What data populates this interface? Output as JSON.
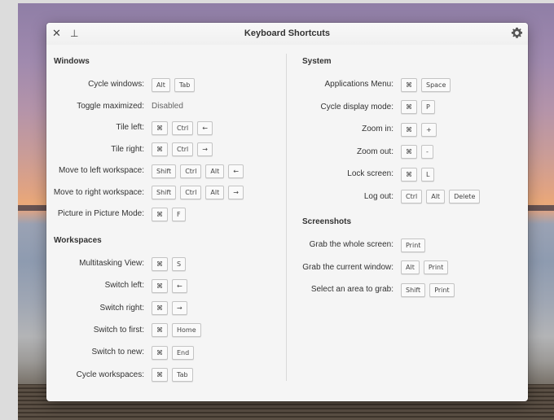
{
  "window": {
    "title": "Keyboard Shortcuts"
  },
  "left": {
    "windows_title": "Windows",
    "windows": [
      {
        "label": "Cycle windows:",
        "keys": [
          "Alt",
          "Tab"
        ]
      },
      {
        "label": "Toggle maximized:",
        "value": "Disabled"
      },
      {
        "label": "Tile left:",
        "keys": [
          "⌘",
          "Ctrl",
          "←"
        ]
      },
      {
        "label": "Tile right:",
        "keys": [
          "⌘",
          "Ctrl",
          "→"
        ]
      },
      {
        "label": "Move to left workspace:",
        "keys": [
          "Shift",
          "Ctrl",
          "Alt",
          "←"
        ]
      },
      {
        "label": "Move to right workspace:",
        "keys": [
          "Shift",
          "Ctrl",
          "Alt",
          "→"
        ]
      },
      {
        "label": "Picture in Picture Mode:",
        "keys": [
          "⌘",
          "F"
        ]
      }
    ],
    "workspaces_title": "Workspaces",
    "workspaces": [
      {
        "label": "Multitasking View:",
        "keys": [
          "⌘",
          "S"
        ]
      },
      {
        "label": "Switch left:",
        "keys": [
          "⌘",
          "←"
        ]
      },
      {
        "label": "Switch right:",
        "keys": [
          "⌘",
          "→"
        ]
      },
      {
        "label": "Switch to first:",
        "keys": [
          "⌘",
          "Home"
        ]
      },
      {
        "label": "Switch to new:",
        "keys": [
          "⌘",
          "End"
        ]
      },
      {
        "label": "Cycle workspaces:",
        "keys": [
          "⌘",
          "Tab"
        ]
      }
    ]
  },
  "right": {
    "system_title": "System",
    "system": [
      {
        "label": "Applications Menu:",
        "keys": [
          "⌘",
          "Space"
        ]
      },
      {
        "label": "Cycle display mode:",
        "keys": [
          "⌘",
          "P"
        ]
      },
      {
        "label": "Zoom in:",
        "keys": [
          "⌘",
          "+"
        ]
      },
      {
        "label": "Zoom out:",
        "keys": [
          "⌘",
          "-"
        ]
      },
      {
        "label": "Lock screen:",
        "keys": [
          "⌘",
          "L"
        ]
      },
      {
        "label": "Log out:",
        "keys": [
          "Ctrl",
          "Alt",
          "Delete"
        ]
      }
    ],
    "screenshots_title": "Screenshots",
    "screenshots": [
      {
        "label": "Grab the whole screen:",
        "keys": [
          "Print"
        ]
      },
      {
        "label": "Grab the current window:",
        "keys": [
          "Alt",
          "Print"
        ]
      },
      {
        "label": "Select an area to grab:",
        "keys": [
          "Shift",
          "Print"
        ]
      }
    ]
  },
  "icons": {
    "close": "close-icon",
    "pin": "pin-icon",
    "settings": "gear-icon"
  }
}
